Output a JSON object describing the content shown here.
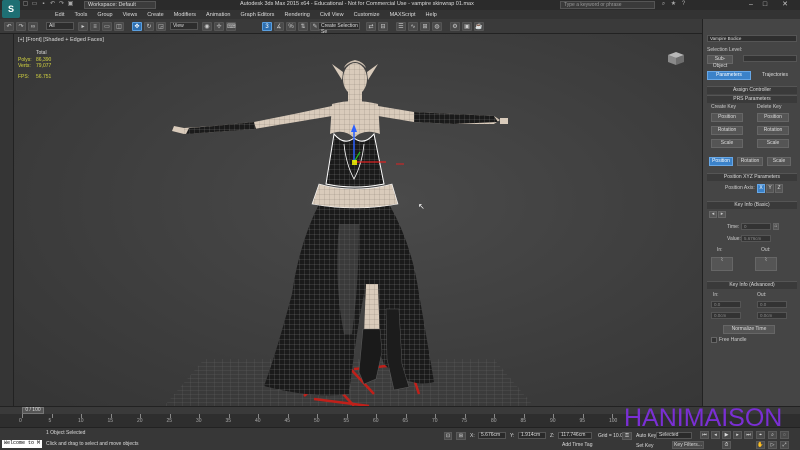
{
  "titlebar": {
    "workspace": "Workspace: Default",
    "title": "Autodesk 3ds Max 2015 x64 - Educational - Not for Commercial Use - vampire skinwrap 01.max",
    "search_placeholder": "Type a keyword or phrase"
  },
  "menu": [
    "Edit",
    "Tools",
    "Group",
    "Views",
    "Create",
    "Modifiers",
    "Animation",
    "Graph Editors",
    "Rendering",
    "Civil View",
    "Customize",
    "MAXScript",
    "Help"
  ],
  "toolbar": {
    "selection_filter": "All",
    "reference_coord": "View",
    "named_selection": "Create Selection Se"
  },
  "viewport": {
    "label": "[+] [Front] [Shaded + Edged Faces]",
    "stats_header": "Total",
    "polys_label": "Polys:",
    "polys_value": "86,390",
    "verts_label": "Verts:",
    "verts_value": "79,077",
    "fps_label": "FPS:",
    "fps_value": "56.751"
  },
  "command_panel": {
    "object_name": "Vampire Bodice",
    "selection_level": "Selection Level:",
    "sub_object": "Sub-Object",
    "tab_parameters": "Parameters",
    "tab_trajectories": "Trajectories",
    "assign_controller": "Assign Controller",
    "prs_parameters": "PRS Parameters",
    "create_key": "Create Key",
    "delete_key": "Delete Key",
    "position": "Position",
    "rotation": "Rotation",
    "scale": "Scale",
    "position_xyz": "Position XYZ Parameters",
    "position_axis": "Position Axis:",
    "axis_x": "X",
    "axis_y": "Y",
    "axis_z": "Z",
    "key_info_basic": "Key Info (Basic)",
    "time_label": "Time:",
    "time_value": "0",
    "value_label": "Value:",
    "value_value": "5.676cm",
    "in_label": "In:",
    "out_label": "Out:",
    "key_info_advanced": "Key Info (Advanced)",
    "in_field": "0.0",
    "out_field": "0.0",
    "in_field2": "0.0cm",
    "out_field2": "0.0cm",
    "normalize_time": "Normalize Time",
    "free_handle": "Free Handle"
  },
  "timeline": {
    "slider": "0 / 100",
    "ticks": [
      "0",
      "5",
      "10",
      "15",
      "20",
      "25",
      "30",
      "35",
      "40",
      "45",
      "50",
      "55",
      "60",
      "65",
      "70",
      "75",
      "80",
      "85",
      "90",
      "95",
      "100"
    ]
  },
  "status": {
    "maxscript": "Welcome to M",
    "selected": "1 Object Selected",
    "prompt": "Click and drag to select and move objects",
    "x_label": "X:",
    "x_value": "5.676cm",
    "y_label": "Y:",
    "y_value": "1.914cm",
    "z_label": "Z:",
    "z_value": "117.746cm",
    "grid": "Grid = 10.0cm",
    "add_time_tag": "Add Time Tag",
    "auto_key": "Auto Key",
    "set_key": "Set Key",
    "key_mode": "Selected",
    "key_filters": "Key Filters..."
  },
  "watermark": "HANIMAISON",
  "colors": {
    "accent": "#3b82c9",
    "watermark": "#7a2fd4",
    "grid_red": "#c0201a"
  }
}
